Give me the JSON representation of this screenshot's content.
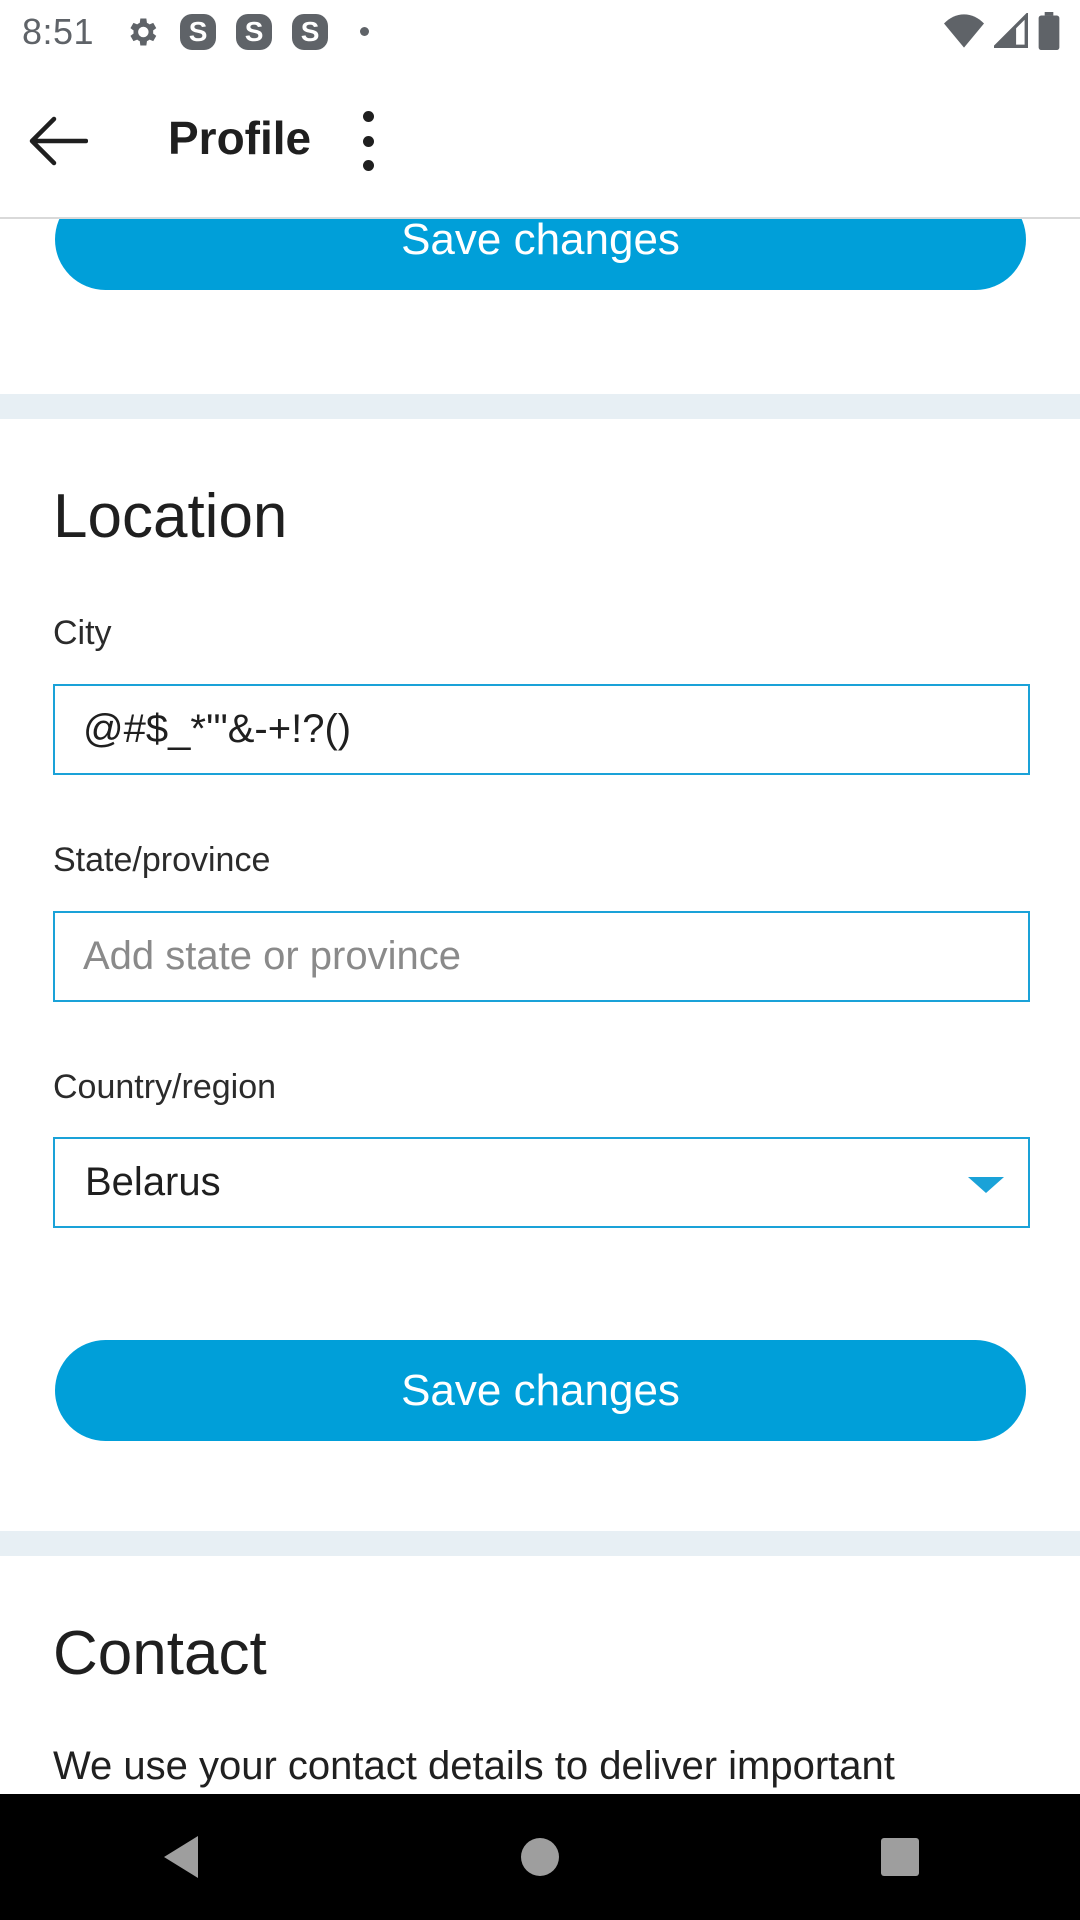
{
  "status_bar": {
    "time": "8:51",
    "notification_icons": [
      "settings-icon",
      "s-app-icon",
      "s-app-icon",
      "s-app-icon"
    ],
    "s_icon_letter": "S",
    "right_icons": [
      "wifi-icon",
      "signal-icon",
      "battery-icon"
    ]
  },
  "app_bar": {
    "title": "Profile",
    "back_icon": "arrow-left-icon",
    "more_icon": "more-vertical-icon"
  },
  "top_save_button": {
    "label": "Save changes"
  },
  "location": {
    "title": "Location",
    "city": {
      "label": "City",
      "value": "@#$_*'\"&-+!?()"
    },
    "state": {
      "label": "State/province",
      "placeholder": "Add state or province",
      "value": ""
    },
    "country": {
      "label": "Country/region",
      "value": "Belarus"
    },
    "save_button": {
      "label": "Save changes"
    }
  },
  "contact": {
    "title": "Contact",
    "description": "We use your contact details to deliver important"
  },
  "colors": {
    "accent": "#009fd9",
    "field_border": "#1aa2d8",
    "section_divider": "#e7eff4"
  },
  "nav_bar": {
    "icons": [
      "back-triangle-icon",
      "home-circle-icon",
      "recents-square-icon"
    ]
  }
}
